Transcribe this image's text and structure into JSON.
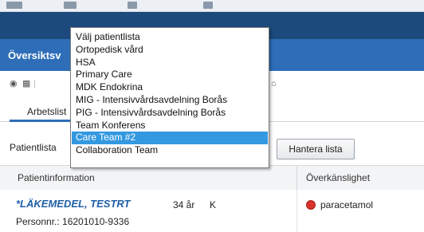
{
  "window": {
    "title": "Översiktsv"
  },
  "tabs": [
    {
      "label": "Arbetslist"
    }
  ],
  "patient_list": {
    "label": "Patientlista",
    "manage_button": "Hantera lista",
    "options": [
      "Välj patientlista",
      "Ortopedisk vård",
      "HSA",
      "Primary Care",
      "MDK Endokrina",
      "MIG - Intensivvårdsavdelning Borås",
      "PIG - Intensivvårdsavdelning Borås",
      "Team Konferens",
      "Care Team #2",
      "Collaboration Team"
    ],
    "selected_index": 8
  },
  "table": {
    "columns": [
      "Patientinformation",
      "Överkänslighet"
    ],
    "rows": [
      {
        "name": "*LÄKEMEDEL, TESTRT",
        "age": "34 år",
        "sex": "K",
        "personnr": "Personnr.: 16201010-9336",
        "allergy": "paracetamol"
      }
    ]
  },
  "colors": {
    "header_blue": "#2e6eb8",
    "brand_dark": "#1c4a7c",
    "selected": "#3399e0",
    "allergy_red": "#d9342b"
  },
  "icons": [
    "binoculars-icon",
    "document-icon",
    "home-icon"
  ]
}
